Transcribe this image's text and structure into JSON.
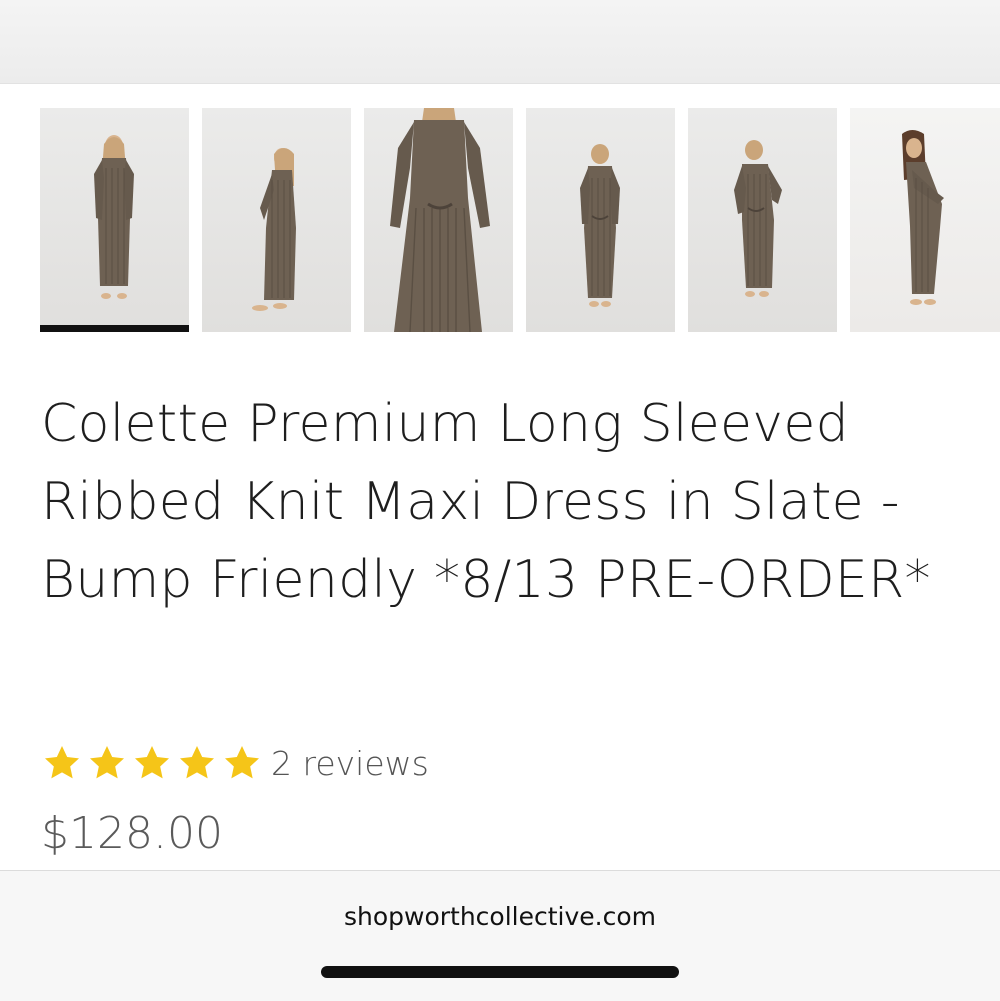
{
  "product": {
    "title": "Colette Premium Long Sleeved Ribbed Knit Maxi Dress in Slate - Bump Friendly *8/13 PRE-ORDER*",
    "rating": {
      "stars": 5,
      "max_stars": 5,
      "reviews_label": "2 reviews"
    },
    "price": "$128.00",
    "gallery": {
      "thumbnail_count": 6,
      "selected_index": 0,
      "thumbnails": [
        {
          "view": "front"
        },
        {
          "view": "side"
        },
        {
          "view": "back-close-up"
        },
        {
          "view": "back"
        },
        {
          "view": "back"
        },
        {
          "view": "side-maternity"
        }
      ]
    }
  },
  "browser": {
    "url": "shopworthcollective.com"
  },
  "colors": {
    "star": "#f5c518",
    "dress": "#6e6153",
    "selected_indicator": "#111111"
  }
}
